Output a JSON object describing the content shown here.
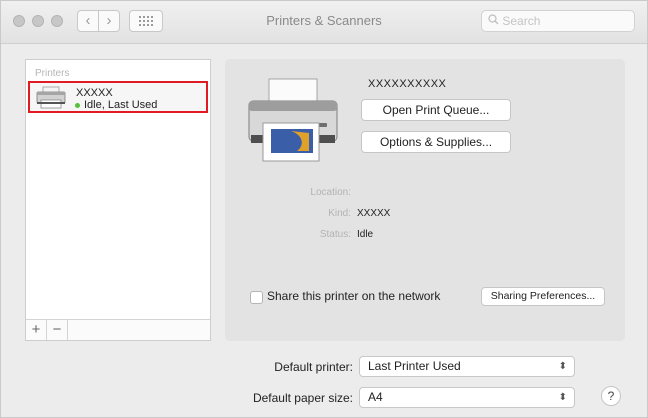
{
  "window": {
    "title": "Printers & Scanners"
  },
  "toolbar": {
    "back_label": "‹",
    "forward_label": "›",
    "grid_icon": "grid-icon",
    "search_placeholder": "Search"
  },
  "sidebar": {
    "header": "Printers",
    "items": [
      {
        "name": "XXXXX",
        "status": "Idle, Last Used",
        "status_color": "#57c13b",
        "selected": true,
        "highlight_color": "#e01b24"
      }
    ],
    "add_label": "+",
    "remove_label": "−"
  },
  "detail": {
    "printer_name": "XXXXXXXXXX",
    "open_queue_label": "Open Print Queue...",
    "options_label": "Options & Supplies...",
    "location_label": "Location:",
    "location_value": "",
    "kind_label": "Kind:",
    "kind_value": "XXXXX",
    "status_label": "Status:",
    "status_value": "Idle",
    "share_label": "Share this printer on the network",
    "share_checked": false,
    "sharing_prefs_label": "Sharing Preferences..."
  },
  "defaults": {
    "printer_label": "Default printer:",
    "printer_value": "Last Printer Used",
    "paper_label": "Default paper size:",
    "paper_value": "A4"
  },
  "help_label": "?"
}
